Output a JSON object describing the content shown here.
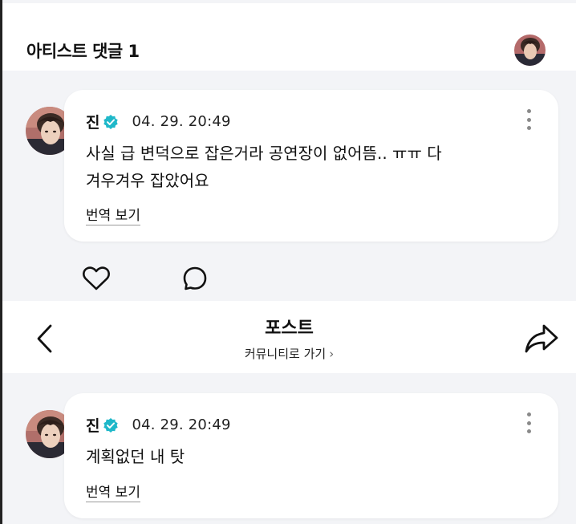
{
  "header": {
    "title": "아티스트 댓글 1"
  },
  "comments": [
    {
      "author": "진",
      "timestamp": "04. 29. 20:49",
      "text_line1": "사실 급 변덕으로 잡은거라 공연장이 없어뜸.. ㅠㅠ 다",
      "text_line2": "겨우겨우 잡았어요",
      "translate_label": "번역 보기"
    },
    {
      "author": "진",
      "timestamp": "04. 29. 20:49",
      "text_line1": "계획없던 내 탓",
      "translate_label": "번역 보기"
    }
  ],
  "nav": {
    "title": "포스트",
    "subtitle": "커뮤니티로 가기"
  },
  "colors": {
    "background": "#f3f4f7",
    "card": "#ffffff",
    "verified_badge": "#1fb8c9",
    "text": "#111111"
  },
  "icons": {
    "verified": "verified-badge-icon",
    "more": "more-vertical-icon",
    "like": "heart-icon",
    "reply": "speech-bubble-icon",
    "back": "chevron-left-icon",
    "share": "share-arrow-icon"
  }
}
